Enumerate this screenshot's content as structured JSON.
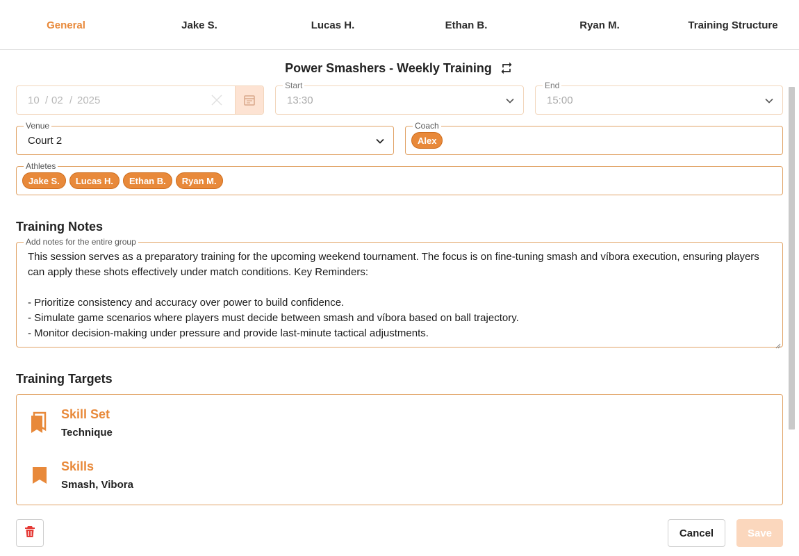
{
  "tabs": [
    {
      "label": "General",
      "active": true
    },
    {
      "label": "Jake S."
    },
    {
      "label": "Lucas H."
    },
    {
      "label": "Ethan B."
    },
    {
      "label": "Ryan M."
    },
    {
      "label": "Training Structure"
    }
  ],
  "header": {
    "title": "Power Smashers - Weekly Training",
    "repeat_icon": "repeat-icon"
  },
  "date": {
    "day": "10",
    "month": "02",
    "year": "2025",
    "sep": "/"
  },
  "start": {
    "label": "Start",
    "value": "13:30"
  },
  "end": {
    "label": "End",
    "value": "15:00"
  },
  "venue": {
    "label": "Venue",
    "value": "Court 2"
  },
  "coach": {
    "label": "Coach",
    "chips": [
      "Alex"
    ]
  },
  "athletes": {
    "label": "Athletes",
    "chips": [
      "Jake S.",
      "Lucas H.",
      "Ethan B.",
      "Ryan M."
    ]
  },
  "notes": {
    "section_title": "Training Notes",
    "label": "Add notes for the entire group",
    "value": "This session serves as a preparatory training for the upcoming weekend tournament. The focus is on fine-tuning smash and víbora execution, ensuring players can apply these shots effectively under match conditions. Key Reminders:\n\n- Prioritize consistency and accuracy over power to build confidence.\n- Simulate game scenarios where players must decide between smash and víbora based on ball trajectory.\n- Monitor decision-making under pressure and provide last-minute tactical adjustments."
  },
  "targets": {
    "section_title": "Training Targets",
    "items": [
      {
        "title": "Skill Set",
        "value": "Technique",
        "icon": "bookmarks-icon"
      },
      {
        "title": "Skills",
        "value": "Smash, Vibora",
        "icon": "bookmark-icon"
      }
    ]
  },
  "actions": {
    "cancel": "Cancel",
    "save": "Save",
    "delete_icon": "trash-icon"
  },
  "colors": {
    "accent": "#e8893a",
    "danger": "#e53935",
    "border": "#e1a366"
  }
}
